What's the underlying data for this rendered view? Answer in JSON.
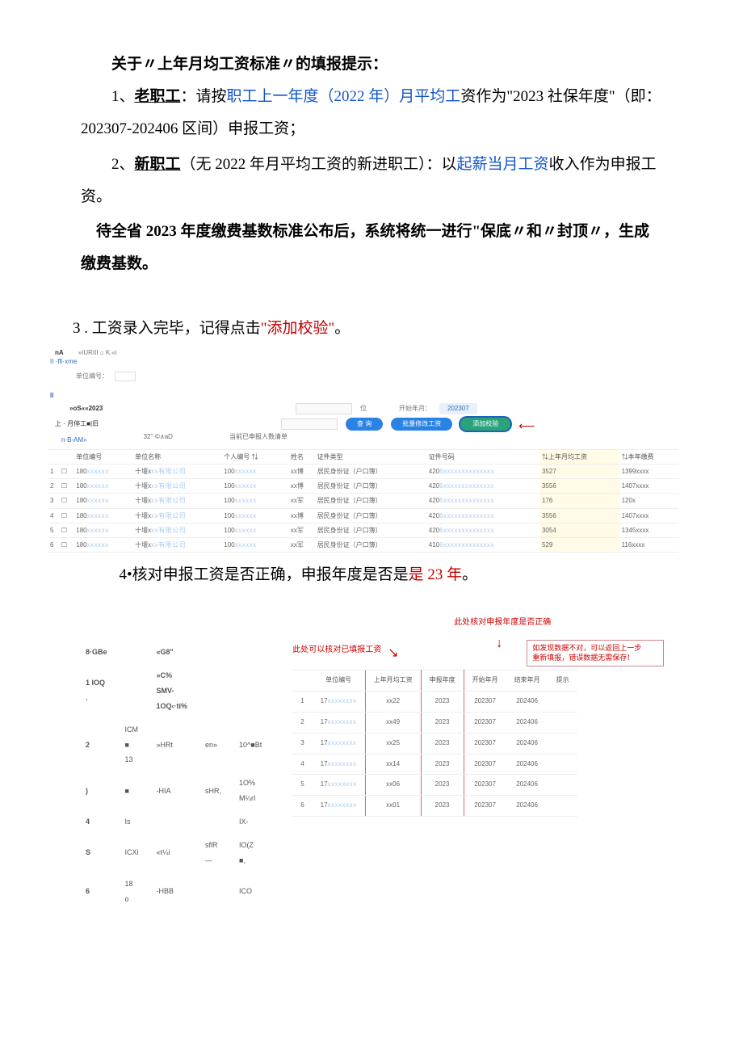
{
  "heading": "关于〃上年月均工资标准〃的填报提示：",
  "p1a": "1、",
  "p1b": "老职工",
  "p1c": "：请按",
  "p1d": "职工上一年度（2022 年）月平均工",
  "p1e": "资作为\"2023 社保年度\"（即：202307-202406 区间）申报工资；",
  "p2a": "2、",
  "p2b": "新职工",
  "p2c": "（无 2022 年月平均工资的新进职工）：以",
  "p2d": "起薪当月工资",
  "p2e": "收入作为申报工资。",
  "p3": "待全省 2023 年度缴费基数标准公布后，系统将统一进行\"保底〃和〃封顶〃，生成缴费基数。",
  "p4a": "3 . 工资录入完毕，记得点击",
  "p4b": "\"添加校验\"",
  "p4c": "。",
  "p5a": "4•核对申报工资是否正确，申报年度是否是",
  "p5b": "是 23 年",
  "p5c": "。",
  "shot1": {
    "top_left": "nA",
    "top_right": "»IURIII ⌂ K.«i",
    "crumb": "II ·ffi·xme",
    "unit_label": "单位编号：",
    "bar": "II",
    "left1": "»oS««2023",
    "left2": "上 · 月停工■|旧",
    "input_hint": "位",
    "start_label": "开始年月：",
    "start_val": "202307",
    "btn1": "查 询",
    "btn2": "批量修改工资",
    "btn3": "添加校验",
    "sub1": "n·B-AM»",
    "sub2": "32\"·©∧aD",
    "sub3": "当前已申报人数清单",
    "headers": [
      "",
      "",
      "单位编号",
      "单位名称",
      "个人编号 ⇅",
      "",
      "姓名",
      "证件类型",
      "证件号码",
      "⇅上年月均工资",
      "⇅本年缴费"
    ],
    "rows": [
      [
        "1",
        "☐",
        "180xxxxxx",
        "十堰xxx有限公司",
        "100xxxxxx",
        "",
        "xx博",
        "居民身份证（户口簿）",
        "4206xxxxxxxxxxxxxx",
        "3527",
        "1399xxxx"
      ],
      [
        "2",
        "☐",
        "180xxxxxx",
        "十堰xxx有限公司",
        "100xxxxxx",
        "",
        "xx博",
        "居民身份证（户口簿）",
        "4206xxxxxxxxxxxxxx",
        "3556",
        "1407xxxx"
      ],
      [
        "3",
        "☐",
        "180xxxxxx",
        "十堰xxx有限公司",
        "100xxxxxx",
        "",
        "xx军",
        "居民身份证（户口簿）",
        "4206xxxxxxxxxxxxxx",
        "176",
        "120x"
      ],
      [
        "4",
        "☐",
        "180xxxxxx",
        "十堰xxx有限公司",
        "100xxxxxx",
        "",
        "xx博",
        "居民身份证（户口簿）",
        "4206xxxxxxxxxxxxxx",
        "3556",
        "1407xxxx"
      ],
      [
        "5",
        "☐",
        "180xxxxxx",
        "十堰xxx有限公司",
        "100xxxxxx",
        "",
        "xx军",
        "居民身份证（户口簿）",
        "4206xxxxxxxxxxxxxx",
        "3054",
        "1345xxxx"
      ],
      [
        "6",
        "☐",
        "180xxxxxx",
        "十堰xxx有限公司",
        "100xxxxxx",
        "",
        "xx军",
        "居民身份证（户口簿）",
        "4106xxxxxxxxxxxxxx",
        "529",
        "116xxxx"
      ]
    ]
  },
  "lefttbl": {
    "r0": [
      "8·GBe",
      "",
      "«G8\"",
      "",
      ""
    ],
    "r1": [
      "1 IOQ .",
      "",
      "»C% SMV- 1OQ‹·ti%",
      "",
      ""
    ],
    "r2": [
      "2",
      "ICM ■ 13",
      "»HRt",
      "en»",
      "10^■Bt"
    ],
    "r3": [
      ")",
      "■",
      "-HIA",
      "sHR,",
      "1O% M¼rI"
    ],
    "r4": [
      "4",
      "Is",
      "",
      "",
      "IX-"
    ],
    "r5": [
      "S",
      "ICXi",
      "«t¼i",
      "sflR —",
      "IO(Z ■,"
    ],
    "r6": [
      "6",
      "18 o",
      "-HBB",
      "",
      "ICO"
    ]
  },
  "shot2": {
    "ann_left": "此处可以核对已填报工资",
    "ann_top": "此处核对申报年度是否正确",
    "calloutA": "如发现数据不对，可以返回上一步",
    "calloutB": "重新填报，错误数据无需保存！",
    "headers": [
      "",
      "单位编号",
      "上年月均工资",
      "申报年度",
      "开始年月",
      "结束年月",
      "提示"
    ],
    "rows": [
      [
        "1",
        "17xxxxxxxx",
        "xx22",
        "2023",
        "202307",
        "202406",
        ""
      ],
      [
        "2",
        "17xxxxxxxx",
        "xx49",
        "2023",
        "202307",
        "202406",
        ""
      ],
      [
        "3",
        "17xxxxxxxx",
        "xx25",
        "2023",
        "202307",
        "202406",
        ""
      ],
      [
        "4",
        "17xxxxxxxx",
        "xx14",
        "2023",
        "202307",
        "202406",
        ""
      ],
      [
        "5",
        "17xxxxxxxx",
        "xx06",
        "2023",
        "202307",
        "202406",
        ""
      ],
      [
        "6",
        "17xxxxxxxx",
        "xx01",
        "2023",
        "202307",
        "202406",
        ""
      ]
    ]
  }
}
